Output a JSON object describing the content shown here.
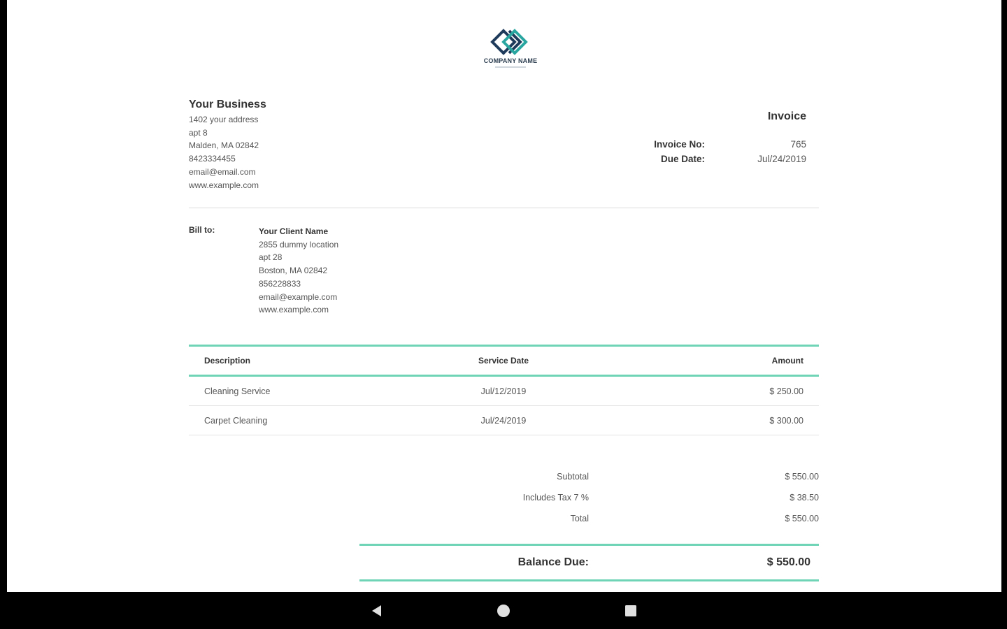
{
  "logo": {
    "company_name": "COMPANY NAME"
  },
  "business": {
    "name": "Your Business",
    "lines": [
      "1402 your address",
      "apt 8",
      "Malden, MA 02842",
      "8423334455",
      "email@email.com",
      "www.example.com"
    ]
  },
  "invoice": {
    "title": "Invoice",
    "number_label": "Invoice No:",
    "number": "765",
    "due_label": "Due Date:",
    "due_date": "Jul/24/2019"
  },
  "bill_to": {
    "label": "Bill to:",
    "name": "Your Client Name",
    "lines": [
      "2855 dummy location",
      "apt 28",
      "Boston, MA 02842",
      "856228833",
      "email@example.com",
      "www.example.com"
    ]
  },
  "items": {
    "headers": [
      "Description",
      "Service Date",
      "Amount"
    ],
    "rows": [
      {
        "description": "Cleaning Service",
        "date": "Jul/12/2019",
        "amount": "$ 250.00"
      },
      {
        "description": "Carpet Cleaning",
        "date": "Jul/24/2019",
        "amount": "$ 300.00"
      }
    ]
  },
  "totals": {
    "subtotal_label": "Subtotal",
    "subtotal": "$ 550.00",
    "tax_label": "Includes Tax 7 %",
    "tax": "$ 38.50",
    "total_label": "Total",
    "total": "$ 550.00"
  },
  "balance": {
    "label": "Balance Due:",
    "value": "$ 550.00"
  },
  "navbar": {
    "back_icon": "back-triangle-icon",
    "home_icon": "home-circle-icon",
    "recent_icon": "recents-square-icon"
  },
  "colors": {
    "accent": "#6fd3b5",
    "logo_dark": "#1f3b5c",
    "logo_teal": "#2aa6a0"
  }
}
